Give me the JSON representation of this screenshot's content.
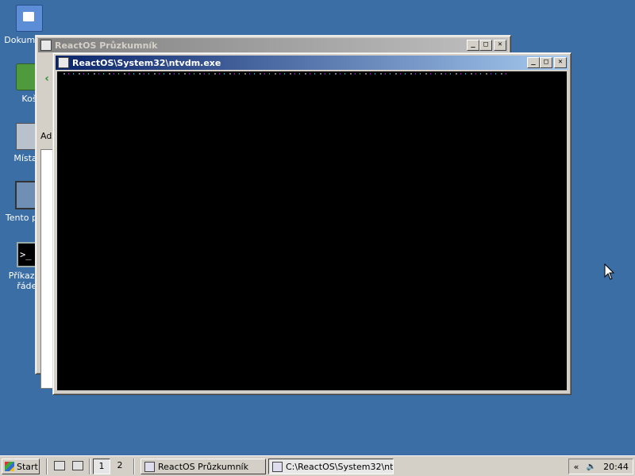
{
  "desktop": {
    "icons": [
      {
        "label": "Dokumenty",
        "icon": "my-documents-icon"
      },
      {
        "label": "Koš",
        "icon": "recycle-bin-icon"
      },
      {
        "label": "Místa v",
        "icon": "network-places-icon"
      },
      {
        "label": "Tento počít",
        "icon": "my-computer-icon"
      },
      {
        "label": "Příkazový řádek",
        "icon": "command-prompt-icon"
      }
    ]
  },
  "explorer": {
    "title": "ReactOS Průzkumník",
    "back_glyph": "‹",
    "address_label": "Ad"
  },
  "console": {
    "title": "ReactOS\\System32\\ntvdm.exe"
  },
  "controls": {
    "minimize": "_",
    "maximize": "□",
    "close": "✕"
  },
  "taskbar": {
    "start_label": "Start",
    "desktops": [
      "1",
      "2"
    ],
    "tasks": [
      {
        "label": "ReactOS Průzkumník",
        "pressed": false
      },
      {
        "label": "C:\\ReactOS\\System32\\nt...",
        "pressed": true
      }
    ],
    "tray": {
      "chevron": "«",
      "volume_glyph": "🔈",
      "clock": "20:44"
    }
  },
  "colors": {
    "desktop": "#3a6ea5",
    "active_title_start": "#0a246a",
    "active_title_end": "#a6caf0",
    "console_bg": "#000000"
  }
}
